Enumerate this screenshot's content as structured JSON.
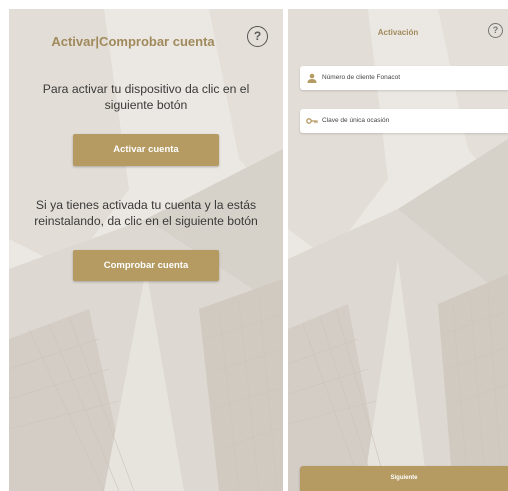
{
  "activation_screen": {
    "title": "Activar|Comprobar cuenta",
    "help_icon": "question-mark-circle-icon",
    "activate_message": "Para activar tu dispositivo da clic en el siguiente botón",
    "activate_button_label": "Activar cuenta",
    "check_message": "Si ya tienes activada tu cuenta y la estás reinstalando, da clic en el siguiente botón",
    "check_button_label": "Comprobar cuenta"
  },
  "activation_form": {
    "title": "Activación",
    "help_icon": "question-mark-circle-icon",
    "client_number_placeholder": "Número de cliente Fonacot",
    "client_number_icon": "person-icon",
    "one_time_key_placeholder": "Clave de única ocasión",
    "one_time_key_icon": "key-icon",
    "next_button_label": "Siguiente"
  },
  "colors": {
    "accent_gold": "#b59a62",
    "title_gold": "#a08a5c",
    "background": "#ebe7e2",
    "text_dark": "#3a3a3a"
  }
}
